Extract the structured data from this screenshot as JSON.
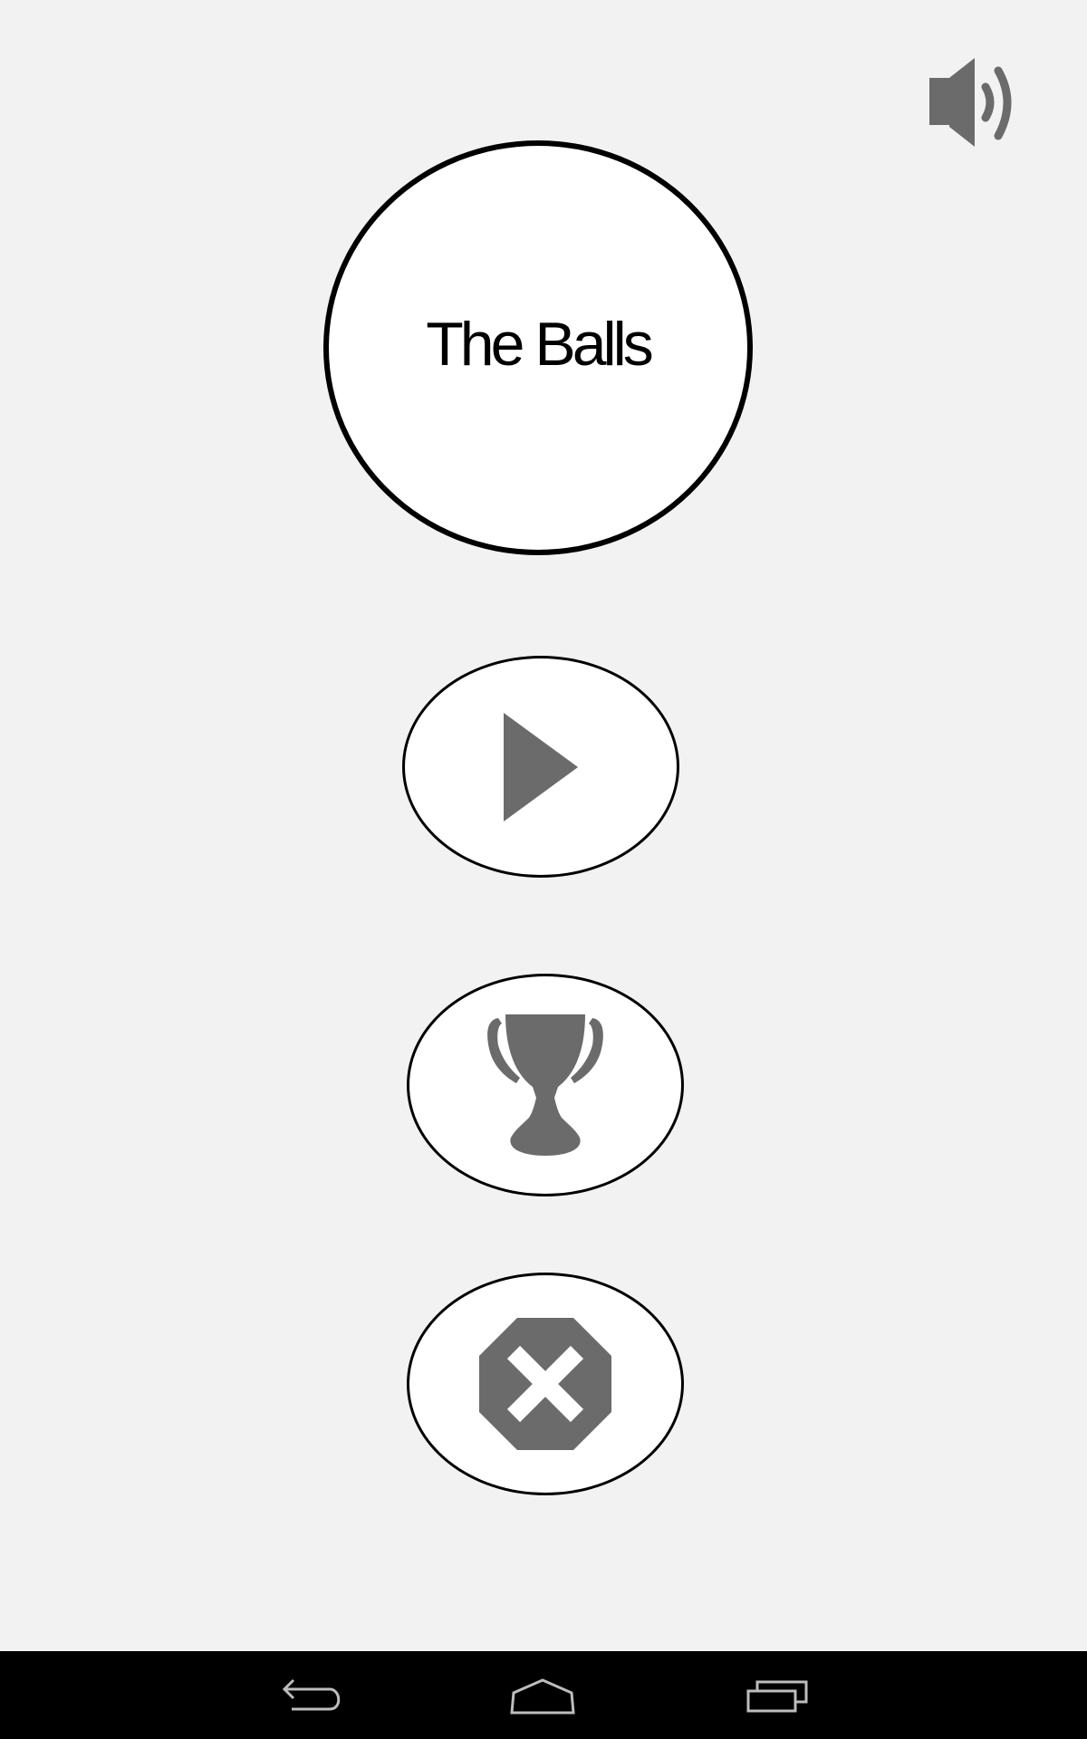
{
  "app": {
    "title": "The Balls"
  },
  "icons": {
    "sound": "speaker-volume-icon",
    "play": "play-icon",
    "leaderboard": "trophy-icon",
    "exit": "close-octagon-icon",
    "nav_back": "back-arrow-icon",
    "nav_home": "home-icon",
    "nav_recents": "recent-apps-icon"
  },
  "colors": {
    "background": "#f2f2f2",
    "icon_gray": "#6b6b6b",
    "outline": "#000000",
    "navbar": "#000000"
  }
}
